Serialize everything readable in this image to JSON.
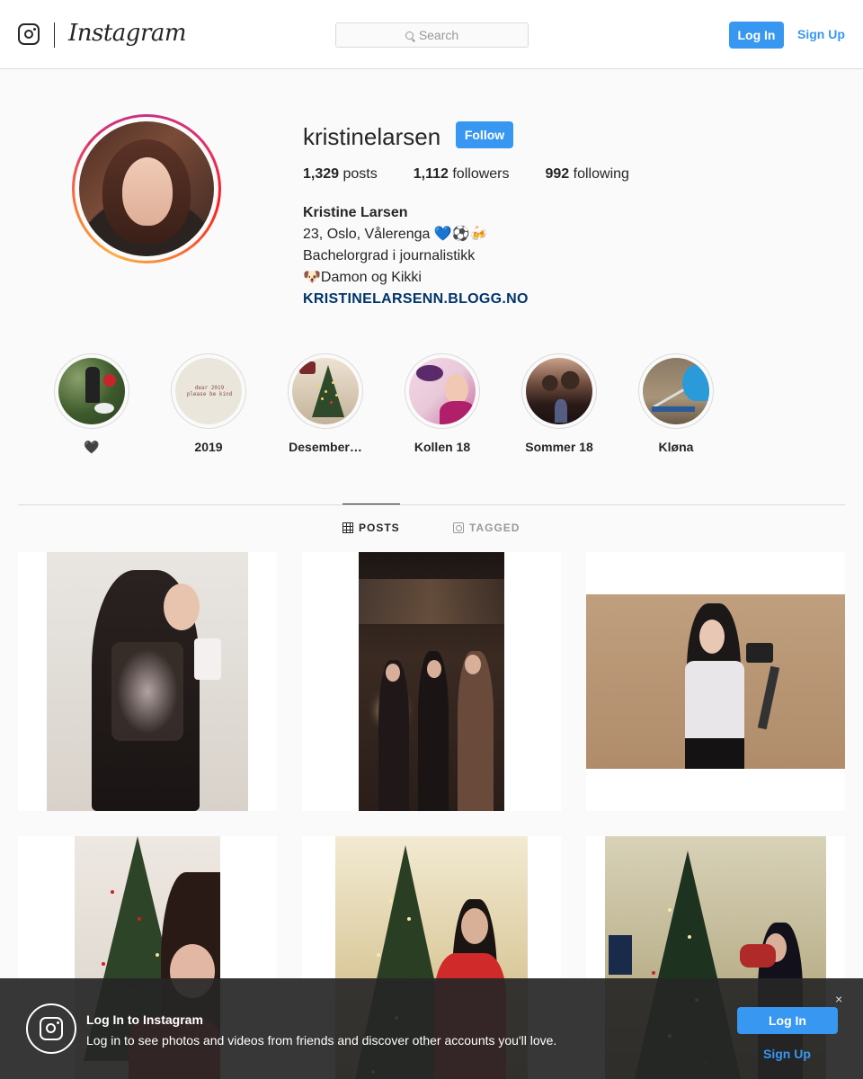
{
  "nav": {
    "brand": "Instagram",
    "search_placeholder": "Search",
    "login_label": "Log In",
    "signup_label": "Sign Up"
  },
  "profile": {
    "username": "kristinelarsen",
    "follow_label": "Follow",
    "stats": {
      "posts_count": "1,329",
      "posts_label": "posts",
      "followers_count": "1,112",
      "followers_label": "followers",
      "following_count": "992",
      "following_label": "following"
    },
    "bio": {
      "full_name": "Kristine Larsen",
      "line1": "23, Oslo, Vålerenga 💙⚽🍻",
      "line2": "Bachelorgrad i journalistikk",
      "line3": "🐶Damon og Kikki",
      "link": "KRISTINELARSENN.BLOGG.NO"
    }
  },
  "highlights": [
    {
      "label": "🖤"
    },
    {
      "label": "2019",
      "cover_text": "dear 2019 please be kind"
    },
    {
      "label": "Desember…"
    },
    {
      "label": "Kollen 18"
    },
    {
      "label": "Sommer 18"
    },
    {
      "label": "Kløna"
    }
  ],
  "tabs": {
    "posts_label": "POSTS",
    "tagged_label": "TAGGED"
  },
  "posts": [
    {
      "description": "mirror selfie in sheer black outfit"
    },
    {
      "description": "three women with sparklers at night"
    },
    {
      "description": "mirror selfie with camera"
    },
    {
      "description": "selfie in front of christmas tree"
    },
    {
      "description": "woman in red dress by christmas tree"
    },
    {
      "description": "woman decorating christmas tree"
    }
  ],
  "banner": {
    "title": "Log In to Instagram",
    "text": "Log in to see photos and videos from friends and discover other accounts you'll love.",
    "login_label": "Log In",
    "signup_label": "Sign Up",
    "close_glyph": "×"
  }
}
